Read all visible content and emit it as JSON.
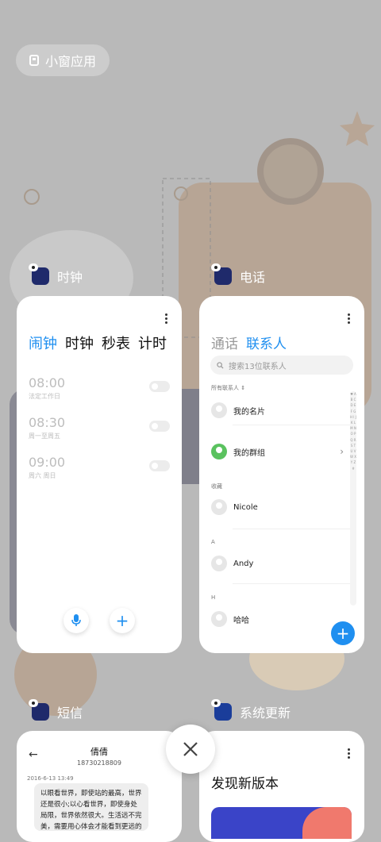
{
  "floating_window_button": {
    "label": "小窗应用"
  },
  "apps": {
    "clock": {
      "name": "时钟",
      "tabs": [
        "闹钟",
        "时钟",
        "秒表",
        "计时"
      ],
      "alarms": [
        {
          "time": "08:00",
          "repeat": "法定工作日"
        },
        {
          "time": "08:30",
          "repeat": "周一至周五"
        },
        {
          "time": "09:00",
          "repeat": "周六 周日"
        }
      ]
    },
    "phone": {
      "name": "电话",
      "tabs": [
        "通话",
        "联系人"
      ],
      "search_placeholder": "搜索13位联系人",
      "all_contacts": "所有联系人",
      "my_card": "我的名片",
      "my_groups": "我的群组",
      "favorites_header": "收藏",
      "favorite_contact": "Nicole",
      "section_a": "A",
      "contact_a": "Andy",
      "section_h": "H",
      "contact_h": "哈哈",
      "alphabet": "♥ A B C D E F G H I J K L M N O P Q R S T U V W X Y Z #"
    },
    "messages": {
      "name": "短信",
      "contact_name": "倩倩",
      "contact_number": "18730218809",
      "date": "2016-6-13 13:49",
      "message": "以眼看世界，即使站的最高，世界还是很小;以心看世界，即使身处局限，世界依然很大。生活远不完美，需要用心体会才能看到更远的风景"
    },
    "system_update": {
      "name": "系统更新",
      "title": "发现新版本"
    }
  },
  "colors": {
    "accent": "#1f8ff0",
    "green": "#5ac25f"
  },
  "icons": [
    "floating-window-icon",
    "clock-app-icon",
    "phone-app-icon",
    "messages-app-icon",
    "update-app-icon",
    "microphone-icon",
    "plus-icon",
    "search-icon",
    "close-icon",
    "back-arrow-icon",
    "more-icon"
  ]
}
